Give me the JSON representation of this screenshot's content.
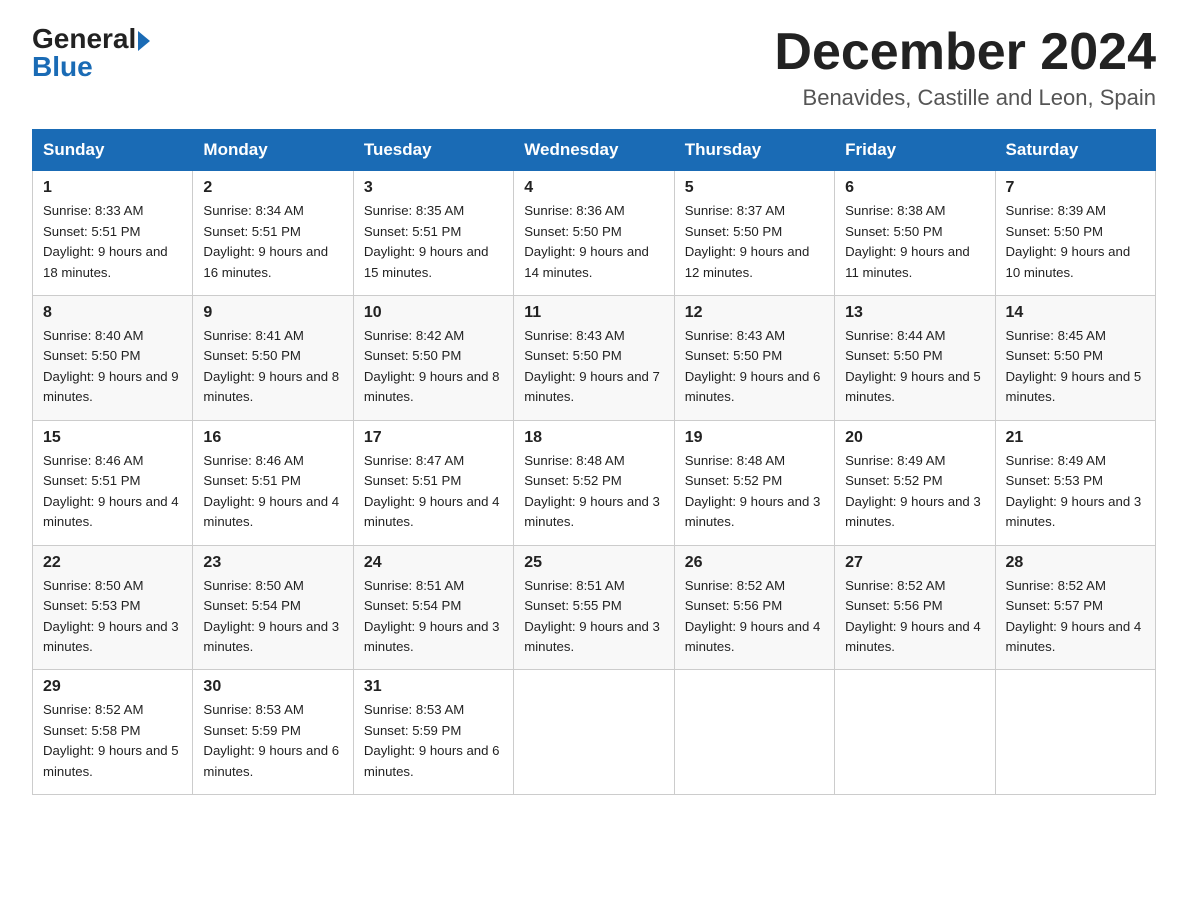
{
  "logo": {
    "part1": "General",
    "part2": "Blue"
  },
  "header": {
    "month": "December 2024",
    "location": "Benavides, Castille and Leon, Spain"
  },
  "days_of_week": [
    "Sunday",
    "Monday",
    "Tuesday",
    "Wednesday",
    "Thursday",
    "Friday",
    "Saturday"
  ],
  "weeks": [
    [
      {
        "day": "1",
        "sunrise": "8:33 AM",
        "sunset": "5:51 PM",
        "daylight": "9 hours and 18 minutes."
      },
      {
        "day": "2",
        "sunrise": "8:34 AM",
        "sunset": "5:51 PM",
        "daylight": "9 hours and 16 minutes."
      },
      {
        "day": "3",
        "sunrise": "8:35 AM",
        "sunset": "5:51 PM",
        "daylight": "9 hours and 15 minutes."
      },
      {
        "day": "4",
        "sunrise": "8:36 AM",
        "sunset": "5:50 PM",
        "daylight": "9 hours and 14 minutes."
      },
      {
        "day": "5",
        "sunrise": "8:37 AM",
        "sunset": "5:50 PM",
        "daylight": "9 hours and 12 minutes."
      },
      {
        "day": "6",
        "sunrise": "8:38 AM",
        "sunset": "5:50 PM",
        "daylight": "9 hours and 11 minutes."
      },
      {
        "day": "7",
        "sunrise": "8:39 AM",
        "sunset": "5:50 PM",
        "daylight": "9 hours and 10 minutes."
      }
    ],
    [
      {
        "day": "8",
        "sunrise": "8:40 AM",
        "sunset": "5:50 PM",
        "daylight": "9 hours and 9 minutes."
      },
      {
        "day": "9",
        "sunrise": "8:41 AM",
        "sunset": "5:50 PM",
        "daylight": "9 hours and 8 minutes."
      },
      {
        "day": "10",
        "sunrise": "8:42 AM",
        "sunset": "5:50 PM",
        "daylight": "9 hours and 8 minutes."
      },
      {
        "day": "11",
        "sunrise": "8:43 AM",
        "sunset": "5:50 PM",
        "daylight": "9 hours and 7 minutes."
      },
      {
        "day": "12",
        "sunrise": "8:43 AM",
        "sunset": "5:50 PM",
        "daylight": "9 hours and 6 minutes."
      },
      {
        "day": "13",
        "sunrise": "8:44 AM",
        "sunset": "5:50 PM",
        "daylight": "9 hours and 5 minutes."
      },
      {
        "day": "14",
        "sunrise": "8:45 AM",
        "sunset": "5:50 PM",
        "daylight": "9 hours and 5 minutes."
      }
    ],
    [
      {
        "day": "15",
        "sunrise": "8:46 AM",
        "sunset": "5:51 PM",
        "daylight": "9 hours and 4 minutes."
      },
      {
        "day": "16",
        "sunrise": "8:46 AM",
        "sunset": "5:51 PM",
        "daylight": "9 hours and 4 minutes."
      },
      {
        "day": "17",
        "sunrise": "8:47 AM",
        "sunset": "5:51 PM",
        "daylight": "9 hours and 4 minutes."
      },
      {
        "day": "18",
        "sunrise": "8:48 AM",
        "sunset": "5:52 PM",
        "daylight": "9 hours and 3 minutes."
      },
      {
        "day": "19",
        "sunrise": "8:48 AM",
        "sunset": "5:52 PM",
        "daylight": "9 hours and 3 minutes."
      },
      {
        "day": "20",
        "sunrise": "8:49 AM",
        "sunset": "5:52 PM",
        "daylight": "9 hours and 3 minutes."
      },
      {
        "day": "21",
        "sunrise": "8:49 AM",
        "sunset": "5:53 PM",
        "daylight": "9 hours and 3 minutes."
      }
    ],
    [
      {
        "day": "22",
        "sunrise": "8:50 AM",
        "sunset": "5:53 PM",
        "daylight": "9 hours and 3 minutes."
      },
      {
        "day": "23",
        "sunrise": "8:50 AM",
        "sunset": "5:54 PM",
        "daylight": "9 hours and 3 minutes."
      },
      {
        "day": "24",
        "sunrise": "8:51 AM",
        "sunset": "5:54 PM",
        "daylight": "9 hours and 3 minutes."
      },
      {
        "day": "25",
        "sunrise": "8:51 AM",
        "sunset": "5:55 PM",
        "daylight": "9 hours and 3 minutes."
      },
      {
        "day": "26",
        "sunrise": "8:52 AM",
        "sunset": "5:56 PM",
        "daylight": "9 hours and 4 minutes."
      },
      {
        "day": "27",
        "sunrise": "8:52 AM",
        "sunset": "5:56 PM",
        "daylight": "9 hours and 4 minutes."
      },
      {
        "day": "28",
        "sunrise": "8:52 AM",
        "sunset": "5:57 PM",
        "daylight": "9 hours and 4 minutes."
      }
    ],
    [
      {
        "day": "29",
        "sunrise": "8:52 AM",
        "sunset": "5:58 PM",
        "daylight": "9 hours and 5 minutes."
      },
      {
        "day": "30",
        "sunrise": "8:53 AM",
        "sunset": "5:59 PM",
        "daylight": "9 hours and 6 minutes."
      },
      {
        "day": "31",
        "sunrise": "8:53 AM",
        "sunset": "5:59 PM",
        "daylight": "9 hours and 6 minutes."
      },
      null,
      null,
      null,
      null
    ]
  ]
}
